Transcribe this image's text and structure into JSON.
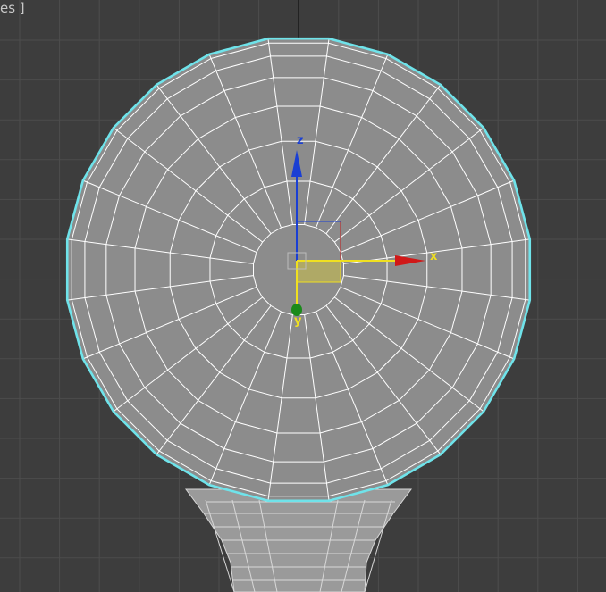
{
  "viewport": {
    "label": "es ]",
    "background": "#3d3d3d",
    "grid_color": "#4d4d4d",
    "home_grid_color": "#111111"
  },
  "object": {
    "wire_color": "#ffffff",
    "face_color": "#8c8c8c",
    "selection_outline_color": "#6fe3ea",
    "segments": 24,
    "rings": 8
  },
  "gizmo": {
    "x_label": "x",
    "y_label": "y",
    "z_label": "z",
    "x_color": "#d01818",
    "y_color": "#1a8a1a",
    "z_color": "#1a3fd4",
    "active_axis_color": "#f0e020"
  }
}
